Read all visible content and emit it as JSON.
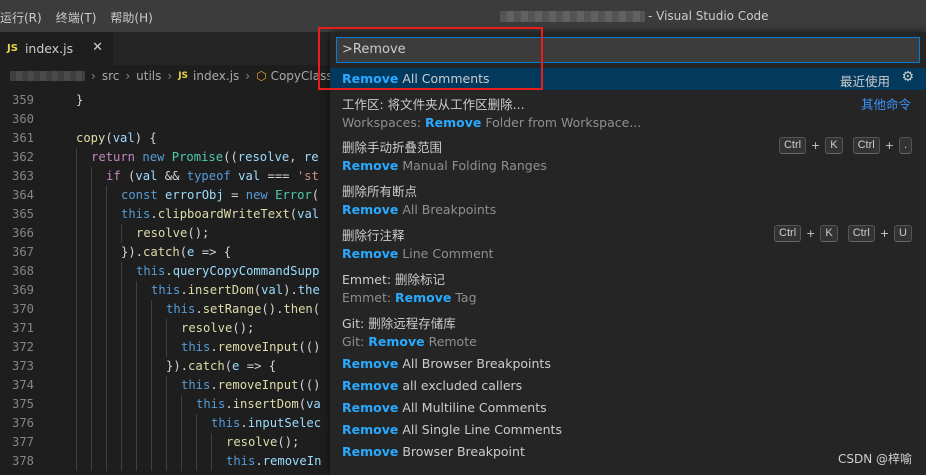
{
  "menu": [
    "运行(R)",
    "终端(T)",
    "帮助(H)"
  ],
  "window_title": "- Visual Studio Code",
  "tab": {
    "badge": "JS",
    "name": "index.js",
    "close": "✕"
  },
  "breadcrumb": [
    "src",
    "utils",
    "index.js",
    "CopyClass"
  ],
  "breadcrumb_js_badge": "JS",
  "editor": {
    "lines": [
      {
        "n": "359",
        "indent": 0,
        "code": "}"
      },
      {
        "n": "360",
        "indent": 0,
        "code": ""
      },
      {
        "n": "361",
        "indent": 0,
        "code": "copy(val) {"
      },
      {
        "n": "362",
        "indent": 1,
        "code": "return new Promise((resolve, re"
      },
      {
        "n": "363",
        "indent": 2,
        "code": "if (val && typeof val === 'st"
      },
      {
        "n": "364",
        "indent": 3,
        "code": "const errorObj = new Error("
      },
      {
        "n": "365",
        "indent": 3,
        "code": "this.clipboardWriteText(val"
      },
      {
        "n": "366",
        "indent": 4,
        "code": "resolve();"
      },
      {
        "n": "367",
        "indent": 3,
        "code": "}).catch(e => {"
      },
      {
        "n": "368",
        "indent": 4,
        "code": "this.queryCopyCommandSupp"
      },
      {
        "n": "369",
        "indent": 5,
        "code": "this.insertDom(val).the"
      },
      {
        "n": "370",
        "indent": 6,
        "code": "this.setRange().then("
      },
      {
        "n": "371",
        "indent": 7,
        "code": "resolve();"
      },
      {
        "n": "372",
        "indent": 7,
        "code": "this.removeInput(()"
      },
      {
        "n": "373",
        "indent": 6,
        "code": "}).catch(e => {"
      },
      {
        "n": "374",
        "indent": 7,
        "code": "this.removeInput(()"
      },
      {
        "n": "375",
        "indent": 8,
        "code": "this.insertDom(va"
      },
      {
        "n": "376",
        "indent": 9,
        "code": "this.inputSelec"
      },
      {
        "n": "377",
        "indent": 10,
        "code": "resolve();"
      },
      {
        "n": "378",
        "indent": 10,
        "code": "this.removeIn"
      }
    ]
  },
  "command_palette": {
    "input_value": ">Remove",
    "items": [
      {
        "label_hl": "Remove",
        "label_rest": " All Comments",
        "right": "最近使用",
        "gear": "⚙",
        "active": true
      },
      {
        "label": "工作区: 将文件夹从工作区删除...",
        "detail_pre": "Workspaces: ",
        "detail_hl": "Remove",
        "detail_post": " Folder from Workspace...",
        "right_link": "其他命令"
      },
      {
        "label": "删除手动折叠范围",
        "detail_hl": "Remove",
        "detail_post": " Manual Folding Ranges",
        "keys": [
          [
            "Ctrl",
            "K"
          ],
          [
            "Ctrl",
            "."
          ]
        ]
      },
      {
        "label": "删除所有断点",
        "detail_hl": "Remove",
        "detail_post": " All Breakpoints"
      },
      {
        "label": "删除行注释",
        "detail_hl": "Remove",
        "detail_post": " Line Comment",
        "keys": [
          [
            "Ctrl",
            "K"
          ],
          [
            "Ctrl",
            "U"
          ]
        ]
      },
      {
        "label": "Emmet: 删除标记",
        "detail_pre": "Emmet: ",
        "detail_hl": "Remove",
        "detail_post": " Tag"
      },
      {
        "label": "Git: 删除远程存储库",
        "detail_pre": "Git: ",
        "detail_hl": "Remove",
        "detail_post": " Remote"
      },
      {
        "label_hl": "Remove",
        "label_rest": " All Browser Breakpoints"
      },
      {
        "label_hl": "Remove",
        "label_rest": " all excluded callers"
      },
      {
        "label_hl": "Remove",
        "label_rest": " All Multiline Comments"
      },
      {
        "label_hl": "Remove",
        "label_rest": " All Single Line Comments"
      },
      {
        "label_hl": "Remove",
        "label_rest": " Browser Breakpoint"
      }
    ]
  },
  "watermark": "CSDN @梓喻",
  "colors": {
    "accent": "#007fd4",
    "highlight": "#2aaaff",
    "annotation": "#e81e1e",
    "active_row": "#04395e"
  }
}
